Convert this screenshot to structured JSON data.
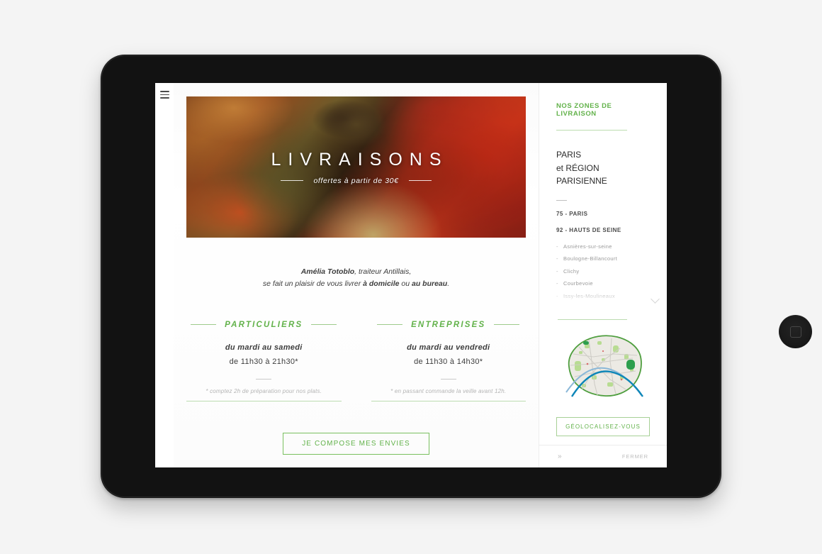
{
  "nav": {
    "menu_icon": "hamburger-icon"
  },
  "hero": {
    "title": "LIVRAISONS",
    "subtitle": "offertes à partir de 30€",
    "image_alt": "cacao-pods-photo"
  },
  "intro": {
    "line1_bold": "Amélia Totoblo",
    "line1_rest": ", traiteur Antillais,",
    "line2_pre": "se fait un plaisir de vous livrer ",
    "line2_bold1": "à domicile",
    "line2_mid": " ou ",
    "line2_bold2": "au bureau",
    "line2_end": "."
  },
  "columns": [
    {
      "title": "PARTICULIERS",
      "days": "du mardi au samedi",
      "hours": "de 11h30 à 21h30*",
      "note": "* comptez 2h de préparation pour nos plats."
    },
    {
      "title": "ENTREPRISES",
      "days": "du mardi au vendredi",
      "hours": "de 11h30 à 14h30*",
      "note": "* en passant commande la veille avant 12h."
    }
  ],
  "cta": {
    "label": "JE COMPOSE MES ENVIES"
  },
  "sidebar": {
    "title": "NOS ZONES DE LIVRAISON",
    "city_line1": "PARIS",
    "city_line2": "et RÉGION PARISIENNE",
    "zones": [
      {
        "label": "75 - PARIS",
        "towns": []
      },
      {
        "label": "92 - HAUTS DE SEINE",
        "towns": [
          "Asnières-sur-seine",
          "Boulogne-Billancourt",
          "Clichy",
          "Courbevoie",
          "Issy-les-Moulineaux"
        ]
      }
    ],
    "expand_icon": "chevron-down-icon",
    "map_alt": "paris-map",
    "geo_button": "GÉOLOCALISEZ-VOUS",
    "footer": {
      "next": "»",
      "close": "FERMER"
    }
  },
  "colors": {
    "green": "#62b24a",
    "green_light": "#bcdcb0",
    "text": "#3d3d3d",
    "muted": "#9a9a9a",
    "page_bg": "#f4f4f4",
    "device": "#121212"
  }
}
